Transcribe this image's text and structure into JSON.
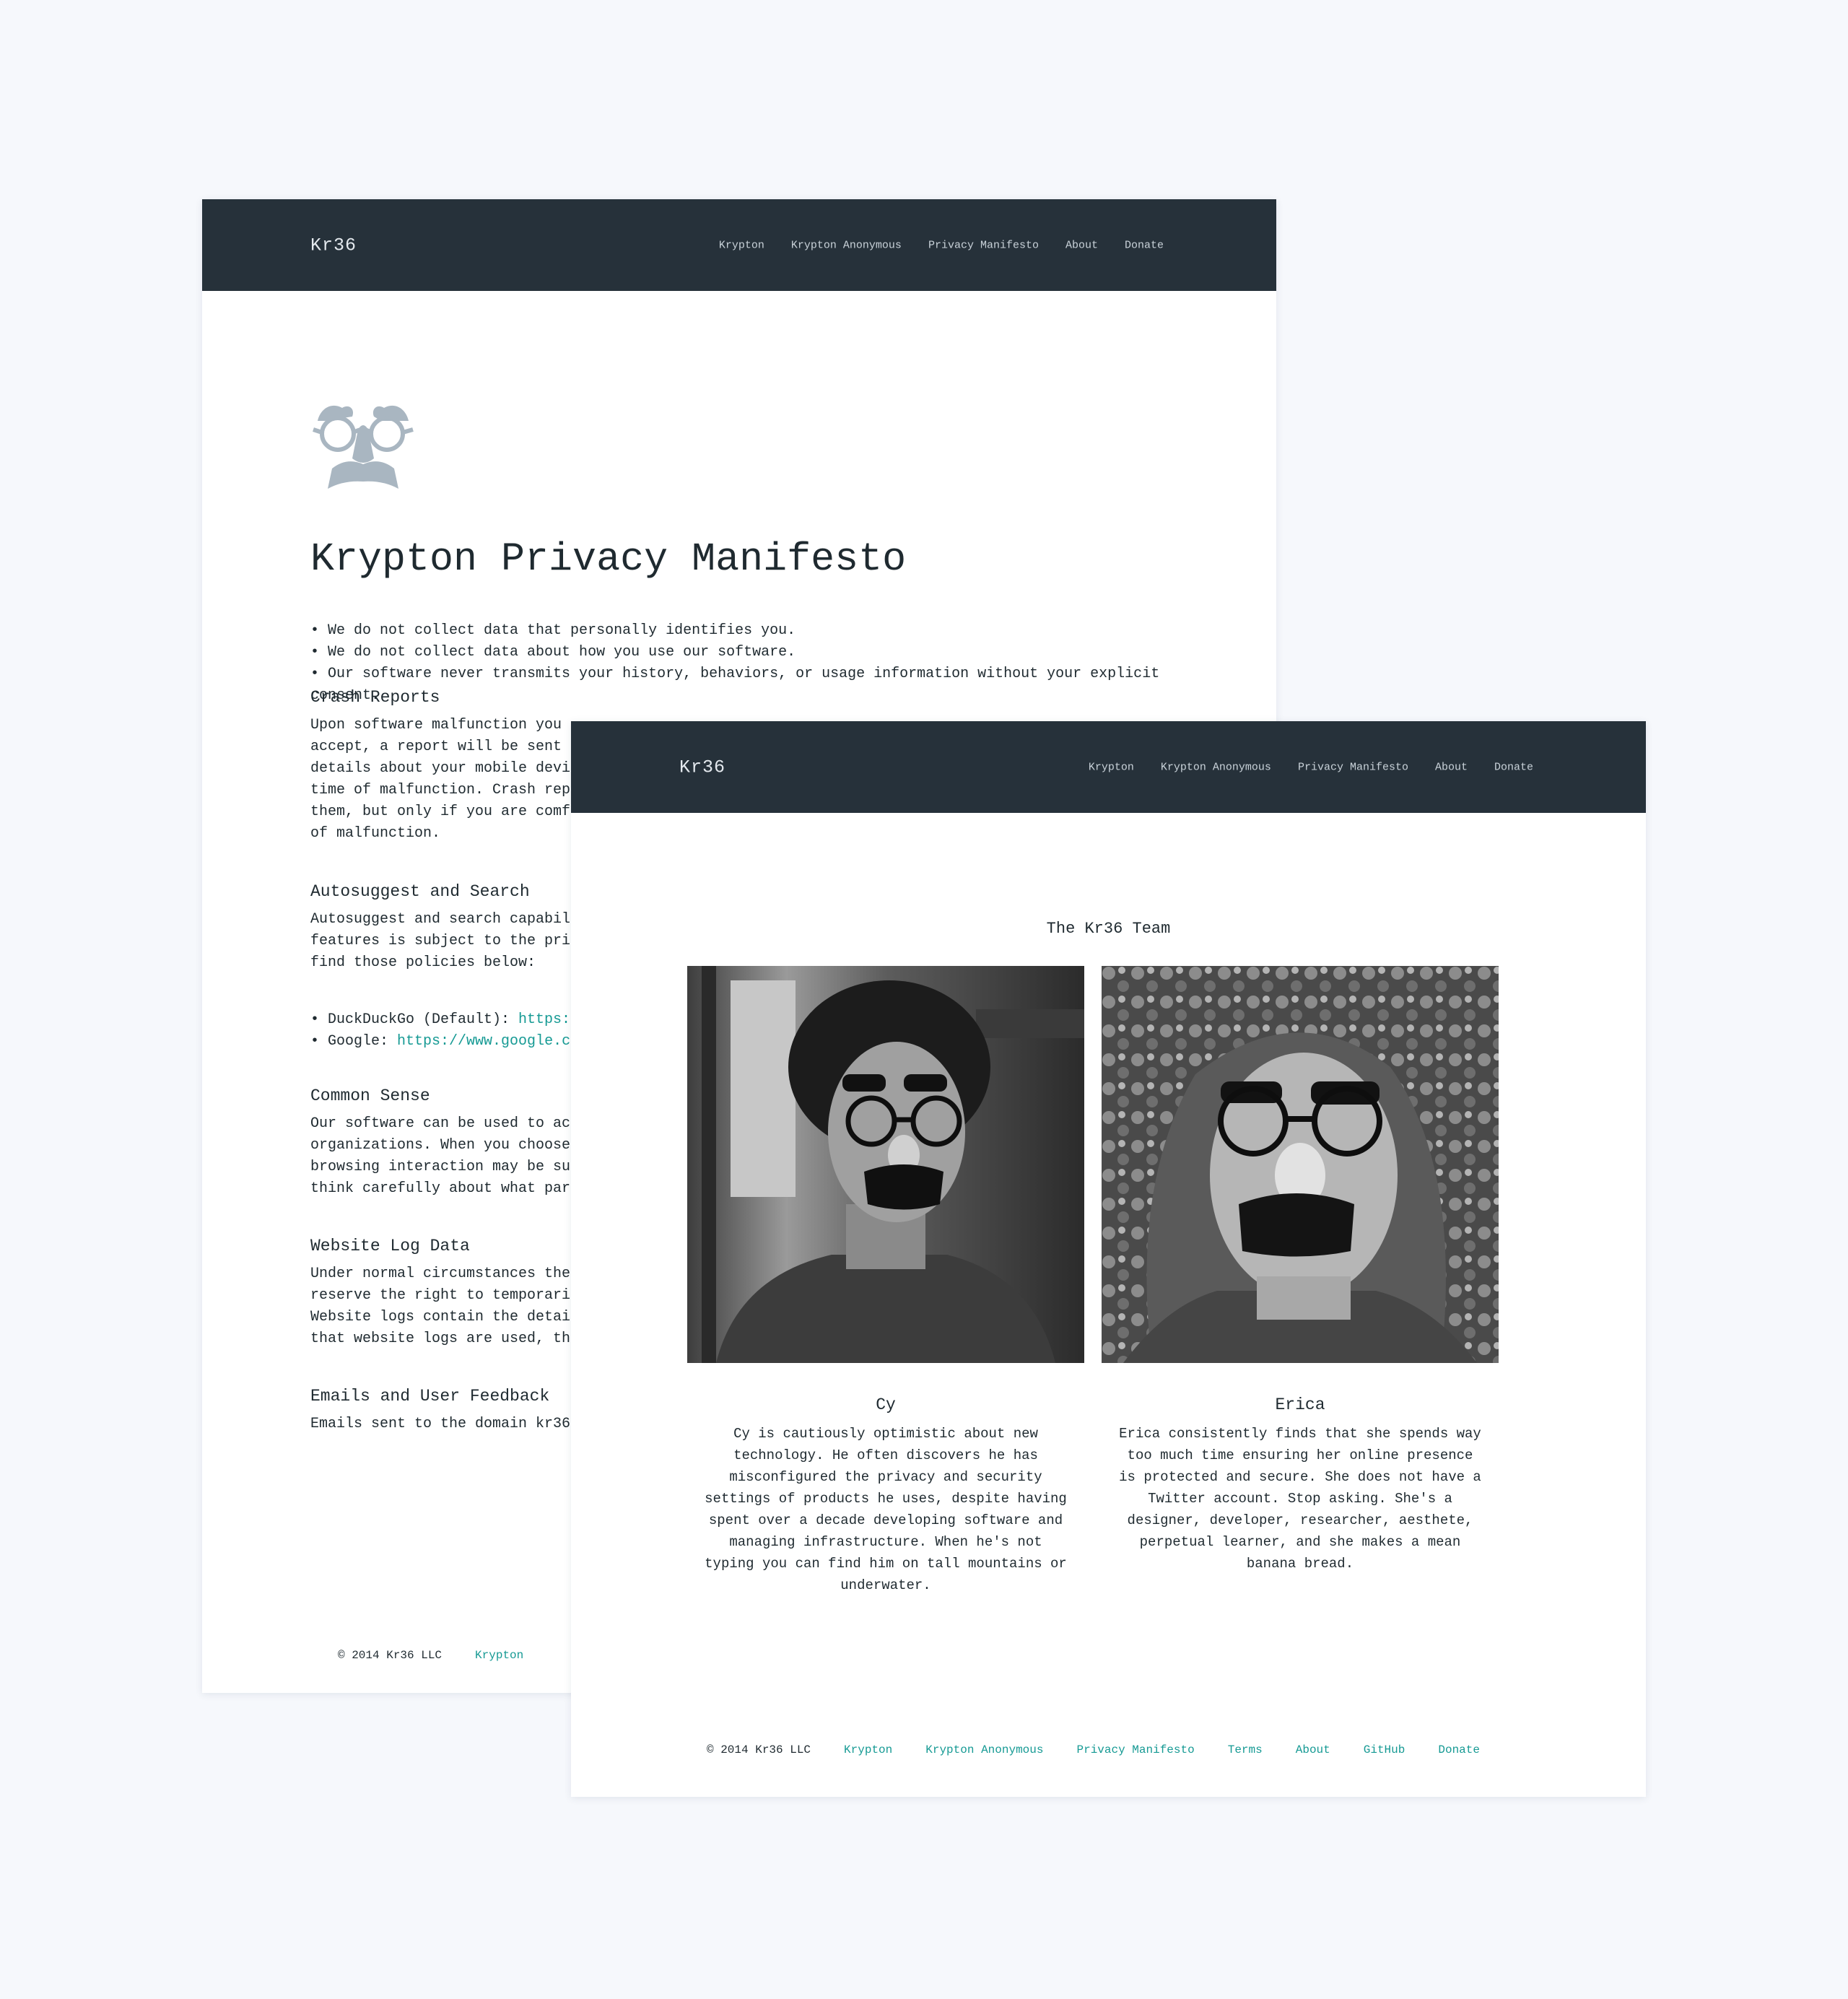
{
  "back_window": {
    "brand": "Kr36",
    "nav": [
      "Krypton",
      "Krypton Anonymous",
      "Privacy Manifesto",
      "About",
      "Donate"
    ],
    "title": "Krypton Privacy Manifesto",
    "bullets": [
      "• We do not collect data that personally identifies you.",
      "• We do not collect data about how you use our software.",
      "• Our software never transmits your history, behaviors, or usage information without your explicit consent."
    ],
    "sections": [
      {
        "heading": "Crash Reports",
        "body": "Upon software malfunction you\naccept, a report will be sent\ndetails about your mobile devi\ntime of malfunction. Crash rep\nthem, but only if you are comf\nof malfunction."
      },
      {
        "heading": "Autosuggest and Search",
        "body": "Autosuggest and search capabil\nfeatures is subject to the pri\nfind those policies below:"
      },
      {
        "heading": "Common Sense",
        "body": "Our software can be used to ac\norganizations. When you choose\nbrowsing interaction may be su\nthink carefully about what par"
      },
      {
        "heading": "Website Log Data",
        "body": "Under normal circumstances the\nreserve the right to temporari\nWebsite logs contain the detai\nthat website logs are used, th"
      },
      {
        "heading": "Emails and User Feedback",
        "body": "Emails sent to the domain kr36"
      }
    ],
    "search_links": [
      {
        "label": "• DuckDuckGo (Default): ",
        "url": "https:/"
      },
      {
        "label": "• Google: ",
        "url": "https://www.google.co"
      }
    ],
    "footer": {
      "copyright": "© 2014  Kr36 LLC",
      "link": "Krypton"
    }
  },
  "front_window": {
    "brand": "Kr36",
    "nav": [
      "Krypton",
      "Krypton Anonymous",
      "Privacy Manifesto",
      "About",
      "Donate"
    ],
    "team_title": "The Kr36 Team",
    "members": [
      {
        "name": "Cy",
        "bio": "Cy is cautiously optimistic about new\ntechnology. He often discovers he has\nmisconfigured the privacy and security\nsettings of products he uses, despite having\nspent over a decade developing software and\nmanaging infrastructure. When he's not\ntyping you can find him on tall mountains or\nunderwater."
      },
      {
        "name": "Erica",
        "bio": "Erica consistently finds that she spends way\ntoo much time ensuring her online presence\nis protected and secure. She does not have a\nTwitter account. Stop asking. She's a\ndesigner, developer, researcher, aesthete,\nperpetual learner, and she makes a mean\nbanana bread."
      }
    ],
    "footer": {
      "copyright": "© 2014  Kr36 LLC",
      "links": [
        "Krypton",
        "Krypton Anonymous",
        "Privacy Manifesto",
        "Terms",
        "About",
        "GitHub",
        "Donate"
      ]
    }
  },
  "colors": {
    "navbar": "#26313a",
    "accent": "#169a94",
    "background": "#f6f8fc"
  }
}
